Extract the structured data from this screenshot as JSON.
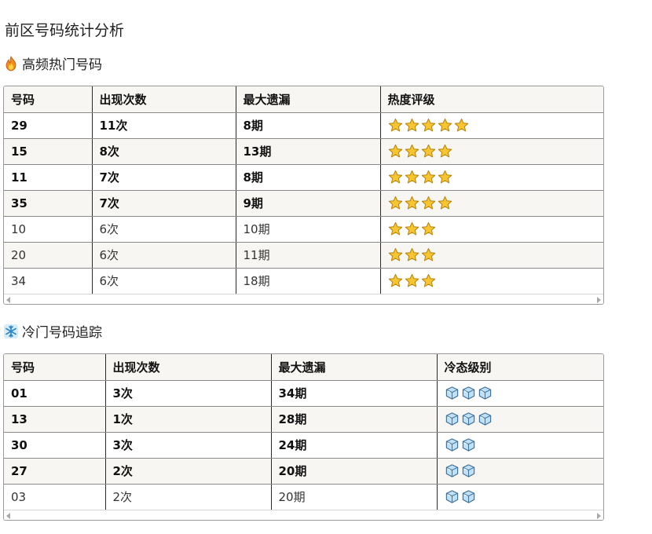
{
  "page_title": "前区号码统计分析",
  "hot": {
    "title": "高频热门号码",
    "icon": "fire-icon",
    "headers": [
      "号码",
      "出现次数",
      "最大遗漏",
      "热度评级"
    ],
    "rows": [
      {
        "number": "29",
        "count": "11次",
        "miss": "8期",
        "stars": 5,
        "bold": true
      },
      {
        "number": "15",
        "count": "8次",
        "miss": "13期",
        "stars": 4,
        "bold": true
      },
      {
        "number": "11",
        "count": "7次",
        "miss": "8期",
        "stars": 4,
        "bold": true
      },
      {
        "number": "35",
        "count": "7次",
        "miss": "9期",
        "stars": 4,
        "bold": true
      },
      {
        "number": "10",
        "count": "6次",
        "miss": "10期",
        "stars": 3,
        "bold": false
      },
      {
        "number": "20",
        "count": "6次",
        "miss": "11期",
        "stars": 3,
        "bold": false
      },
      {
        "number": "34",
        "count": "6次",
        "miss": "18期",
        "stars": 3,
        "bold": false
      }
    ]
  },
  "cold": {
    "title": "冷门号码追踪",
    "icon": "snowflake-icon",
    "headers": [
      "号码",
      "出现次数",
      "最大遗漏",
      "冷态级别"
    ],
    "rows": [
      {
        "number": "01",
        "count": "3次",
        "miss": "34期",
        "ice": 3,
        "bold": true
      },
      {
        "number": "13",
        "count": "1次",
        "miss": "28期",
        "ice": 3,
        "bold": true
      },
      {
        "number": "30",
        "count": "3次",
        "miss": "24期",
        "ice": 2,
        "bold": true
      },
      {
        "number": "27",
        "count": "2次",
        "miss": "20期",
        "ice": 2,
        "bold": true
      },
      {
        "number": "03",
        "count": "2次",
        "miss": "20期",
        "ice": 2,
        "bold": false
      }
    ]
  },
  "colors": {
    "star_fill": "#f7c531",
    "star_stroke": "#b8860b",
    "ice_fill": "#bfe0f7",
    "ice_stroke": "#3b6e99",
    "fire_outer": "#f28c1b",
    "fire_inner": "#ffd23f",
    "snowflake": "#2b87c9"
  }
}
